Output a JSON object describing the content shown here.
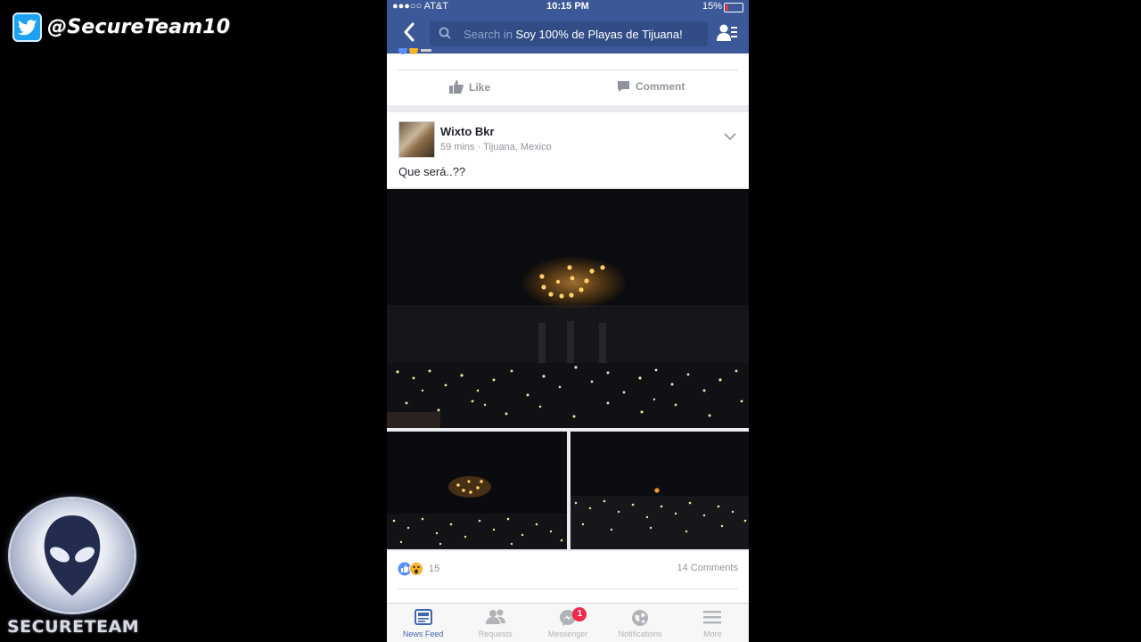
{
  "overlay": {
    "twitter_handle": "@SecureTeam10",
    "logo_text": "SECURETEAM"
  },
  "status_bar": {
    "carrier": "●●●○○ AT&T",
    "time": "10:15 PM",
    "battery": "15%"
  },
  "nav": {
    "search_prefix": "Search in",
    "search_group": "Soy 100% de Playas de Tijuana!"
  },
  "previous_post": {
    "like_label": "Like",
    "comment_label": "Comment"
  },
  "post": {
    "author": "Wixto Bkr",
    "time": "59 mins",
    "location": "Tijuana, Mexico",
    "text": "Que será..??",
    "reaction_count": "15",
    "comment_count": "14 Comments"
  },
  "tabs": [
    {
      "label": "News Feed",
      "icon": "news-feed-icon",
      "active": true
    },
    {
      "label": "Requests",
      "icon": "requests-icon"
    },
    {
      "label": "Messenger",
      "icon": "messenger-icon",
      "badge": "1"
    },
    {
      "label": "Notifications",
      "icon": "notifications-icon"
    },
    {
      "label": "More",
      "icon": "more-icon"
    }
  ],
  "colors": {
    "facebook_blue": "#3b5998",
    "twitter_blue": "#1da1f2",
    "badge_red": "#f02849"
  }
}
